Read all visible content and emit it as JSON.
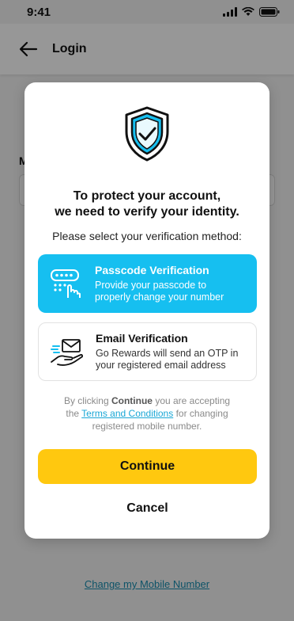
{
  "status_bar": {
    "time": "9:41"
  },
  "header": {
    "title": "Login"
  },
  "background": {
    "field_label": "M",
    "change_mobile_link": "Change my Mobile Number"
  },
  "modal": {
    "title_line1": "To protect your account,",
    "title_line2": "we need to verify your identity.",
    "subtitle": "Please select your verification method:",
    "options": [
      {
        "title": "Passcode Verification",
        "description_line1": "Provide your passcode to",
        "description_line2": "properly change your number",
        "icon": "passcode-keypad-icon",
        "selected": true
      },
      {
        "title": "Email Verification",
        "description_line1": "Go Rewards will send an OTP in",
        "description_line2": "your registered email address",
        "icon": "email-hand-icon",
        "selected": false
      }
    ],
    "terms": {
      "prefix": "By clicking ",
      "bold": "Continue",
      "middle": " you are accepting",
      "the": "the ",
      "link": "Terms and Conditions",
      "suffix": " for changing",
      "line3": "registered mobile number."
    },
    "continue_label": "Continue",
    "cancel_label": "Cancel"
  },
  "colors": {
    "accent_blue": "#16bff0",
    "button_yellow": "#ffc80f",
    "link_blue": "#1aa7d6"
  }
}
